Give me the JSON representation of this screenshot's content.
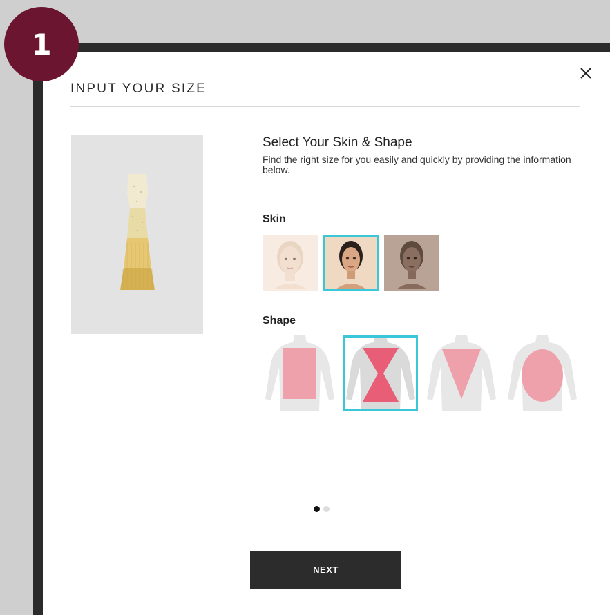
{
  "step_badge": "1",
  "backdrop_text": "...",
  "modal": {
    "title": "INPUT YOUR SIZE",
    "close_icon": "close-icon",
    "product_image": "dress-image",
    "heading": "Select Your Skin & Shape",
    "description": "Find the right size for you easily and quickly by providing the information below.",
    "skin": {
      "label": "Skin",
      "options": [
        {
          "name": "skin-light",
          "bg": "#f8ebe1",
          "face": "#f0d9c8",
          "hair": "#e8d6c2",
          "selected": false
        },
        {
          "name": "skin-medium",
          "bg": "#efd9c2",
          "face": "#d9a784",
          "hair": "#2a211d",
          "selected": true
        },
        {
          "name": "skin-dark",
          "bg": "#b8a396",
          "face": "#8a6e5f",
          "hair": "#4f3c33",
          "selected": false
        }
      ]
    },
    "shape": {
      "label": "Shape",
      "options": [
        {
          "name": "shape-rectangle",
          "selected": false
        },
        {
          "name": "shape-hourglass",
          "selected": true
        },
        {
          "name": "shape-inverted-triangle",
          "selected": false
        },
        {
          "name": "shape-oval",
          "selected": false
        }
      ]
    },
    "pagination": {
      "current": 1,
      "total": 2
    },
    "next_label": "NEXT"
  },
  "colors": {
    "badge": "#6b1530",
    "selection": "#3cc7d8",
    "shape_overlay": "#f08a97",
    "button": "#2c2c2c"
  }
}
